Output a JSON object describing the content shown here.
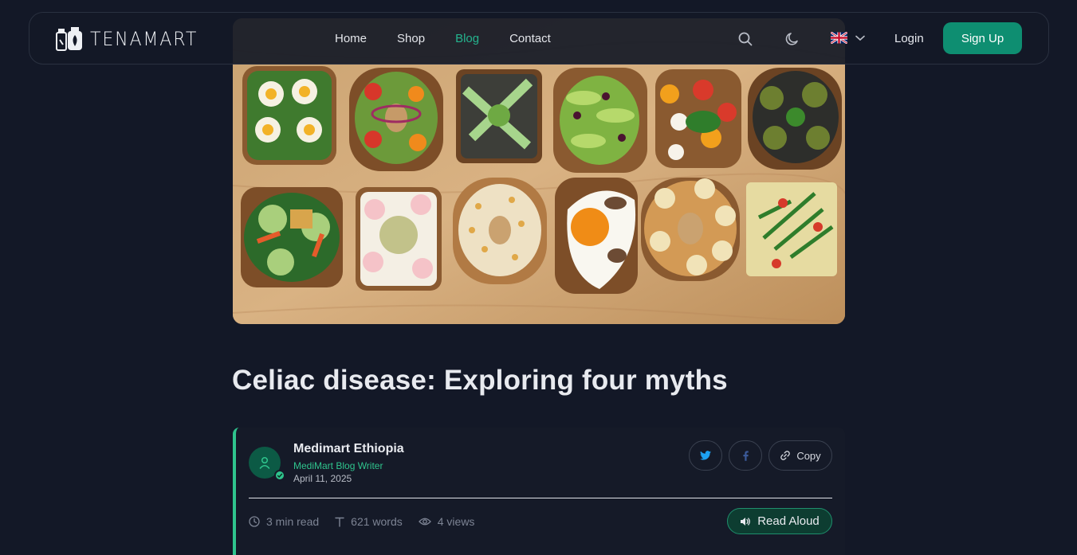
{
  "brand": {
    "name": "TENAMART"
  },
  "nav": {
    "items": [
      {
        "label": "Home",
        "active": false
      },
      {
        "label": "Shop",
        "active": false
      },
      {
        "label": "Blog",
        "active": true
      },
      {
        "label": "Contact",
        "active": false
      }
    ],
    "login_label": "Login",
    "signup_label": "Sign Up",
    "language_icon": "uk-flag-icon"
  },
  "icons": {
    "search": "search-icon",
    "theme": "moon-icon",
    "chevron": "chevron-down-icon"
  },
  "colors": {
    "background": "#131827",
    "accent": "#24b48e",
    "button": "#0e8e71"
  },
  "article": {
    "title": "Celiac disease: Exploring four myths"
  },
  "author": {
    "name": "Medimart Ethiopia",
    "role": "MediMart Blog Writer",
    "date": "April 11, 2025"
  },
  "share": {
    "copy_label": "Copy"
  },
  "stats": {
    "read_time": "3 min read",
    "words": "621 words",
    "views": "4 views"
  },
  "actions": {
    "read_aloud_label": "Read Aloud"
  }
}
